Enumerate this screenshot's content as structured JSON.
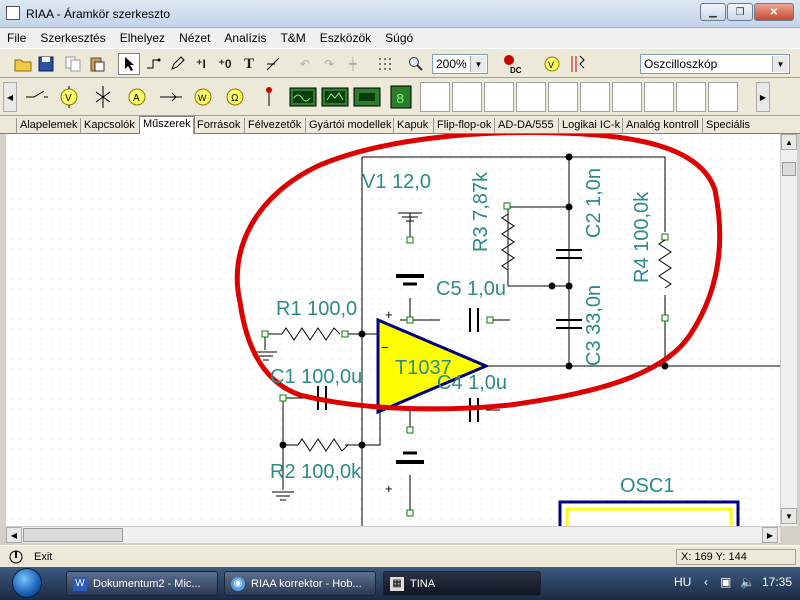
{
  "window": {
    "title": "RIAA - Áramkör szerkeszto"
  },
  "menu": [
    "File",
    "Szerkesztés",
    "Elhelyez",
    "Nézet",
    "Analízis",
    "T&M",
    "Eszközök",
    "Súgó"
  ],
  "toolbar": {
    "zoom": "200%",
    "instrument_select": "Oszcilloszkóp",
    "icons": [
      "open-icon",
      "save-icon",
      "copy-icon",
      "paste-icon",
      "select-pointer-icon",
      "wire-icon",
      "pen-icon",
      "current-source-icon",
      "ground-icon",
      "text-icon",
      "line-text-icon",
      "undo-icon",
      "redo-icon",
      "junction-icon",
      "grid-icon",
      "zoom-icon",
      "dc-analysis-icon",
      "voltmeter-icon",
      "transformer-icon"
    ]
  },
  "palette": {
    "icons": [
      "switch-icon",
      "voltmeter-icon",
      "crossed-wire-icon",
      "ammeter-icon",
      "arrow-wire-icon",
      "wattmeter-icon",
      "ohmmeter-icon",
      "probe-icon",
      "oscilloscope-icon",
      "signal-analyzer-icon",
      "function-generator-icon",
      "logic-display-icon"
    ]
  },
  "tabs": [
    {
      "label": "Alapelemek"
    },
    {
      "label": "Kapcsolók"
    },
    {
      "label": "Műszerek"
    },
    {
      "label": "Források"
    },
    {
      "label": "Félvezetők"
    },
    {
      "label": "Gyártói modellek"
    },
    {
      "label": "Kapuk"
    },
    {
      "label": "Flip-flop-ok"
    },
    {
      "label": "AD-DA/555"
    },
    {
      "label": "Logikai IC-k"
    },
    {
      "label": "Analóg kontroll"
    },
    {
      "label": "Speciális"
    }
  ],
  "tabs_active": "Műszerek",
  "schematic": {
    "labels": {
      "v1": "V1 12,0",
      "r3": "R3 7,87k",
      "c2": "C2 1,0n",
      "r4": "R4 100,0k",
      "c5": "C5 1,0u",
      "c3": "C3 33,0n",
      "r1": "R1 100,0",
      "opamp": "T1037",
      "c1": "C1 100,0u",
      "c4": "C4 1,0u",
      "r2": "R2 100,0k",
      "osc": "OSC1",
      "plus1": "+",
      "plus2": "+",
      "minus": "−"
    },
    "colors": {
      "wire": "#000000",
      "label": "#2c8a8a",
      "component": "#000000",
      "pin": "#008000",
      "opamp_fill": "#ffff00",
      "opamp_stroke": "#000080",
      "annotation": "#dd0000"
    }
  },
  "status": {
    "exit": "Exit",
    "coord": "X: 169  Y: 144"
  },
  "taskbar": {
    "tasks": [
      {
        "label": "Dokumentum2 - Mic...",
        "icon": "word-icon"
      },
      {
        "label": "RIAA korrektor - Hob...",
        "icon": "browser-icon"
      },
      {
        "label": "TINA",
        "icon": "tina-icon"
      }
    ],
    "lang": "HU",
    "time": "17:35"
  }
}
